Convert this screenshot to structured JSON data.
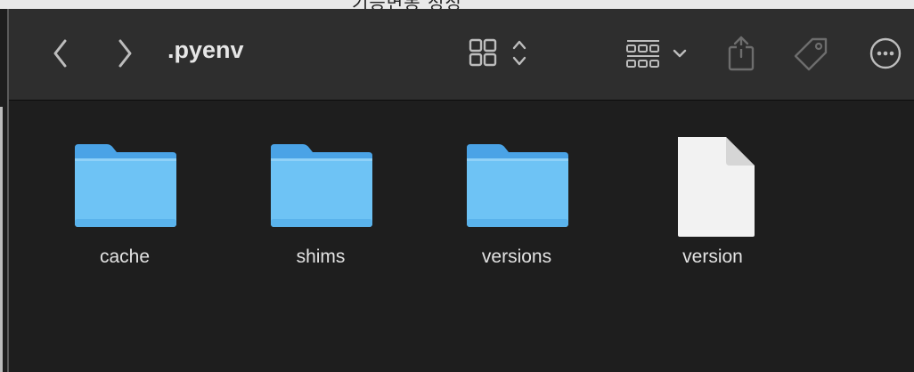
{
  "window": {
    "title": ".pyenv"
  },
  "toolbar": {
    "back_icon": "chevron-left-icon",
    "forward_icon": "chevron-right-icon",
    "view_icon": "icon-grid-view-icon",
    "group_icon": "group-by-icon",
    "share_icon": "share-icon",
    "tag_icon": "tag-icon",
    "more_icon": "ellipsis-circle-icon"
  },
  "items": [
    {
      "name": "cache",
      "kind": "folder"
    },
    {
      "name": "shims",
      "kind": "folder"
    },
    {
      "name": "versions",
      "kind": "folder"
    },
    {
      "name": "version",
      "kind": "file"
    }
  ],
  "colors": {
    "folder": "#6ec3f5",
    "toolbar": "#2e2e2e",
    "content": "#1e1e1e"
  }
}
